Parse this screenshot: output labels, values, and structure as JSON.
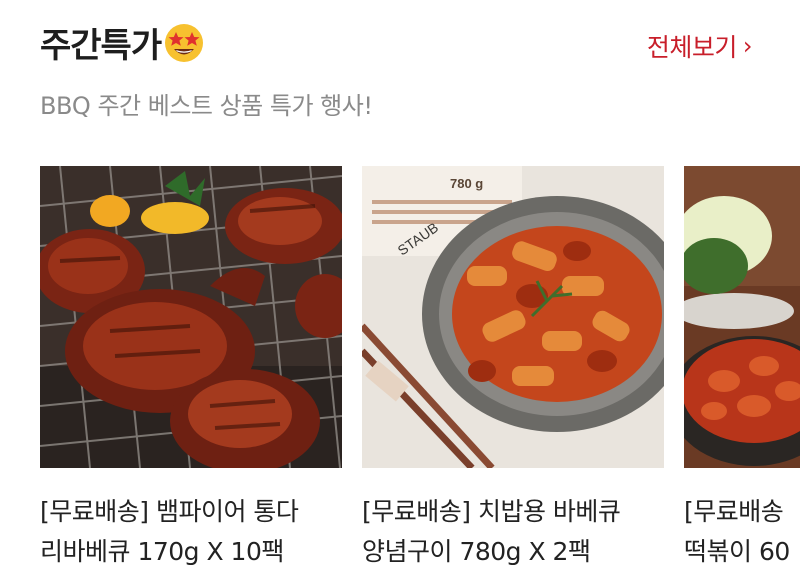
{
  "section": {
    "title": "주간특가",
    "title_emoji": "star-struck-emoji",
    "view_all_label": "전체보기",
    "subtitle": "BBQ 주간 베스트 상품 특가 행사!"
  },
  "colors": {
    "accent": "#c81e2a",
    "title": "#1e1e1e",
    "subtitle": "#8a8a8a"
  },
  "products": [
    {
      "name_line1": "[무료배송] 뱀파이어 통다",
      "name_line2": "리바베큐 170g X 10팩",
      "image": "bbq-chicken-legs-photo"
    },
    {
      "name_line1": "[무료배송] 치밥용 바베큐",
      "name_line2": "양념구이 780g X 2팩",
      "image": "spicy-chicken-tteokbokki-pan-photo",
      "package_text": "780 g"
    },
    {
      "name_line1": "[무료배송",
      "name_line2": "떡볶이 60",
      "image": "chicken-tteokbokki-with-cabbage-photo"
    }
  ]
}
